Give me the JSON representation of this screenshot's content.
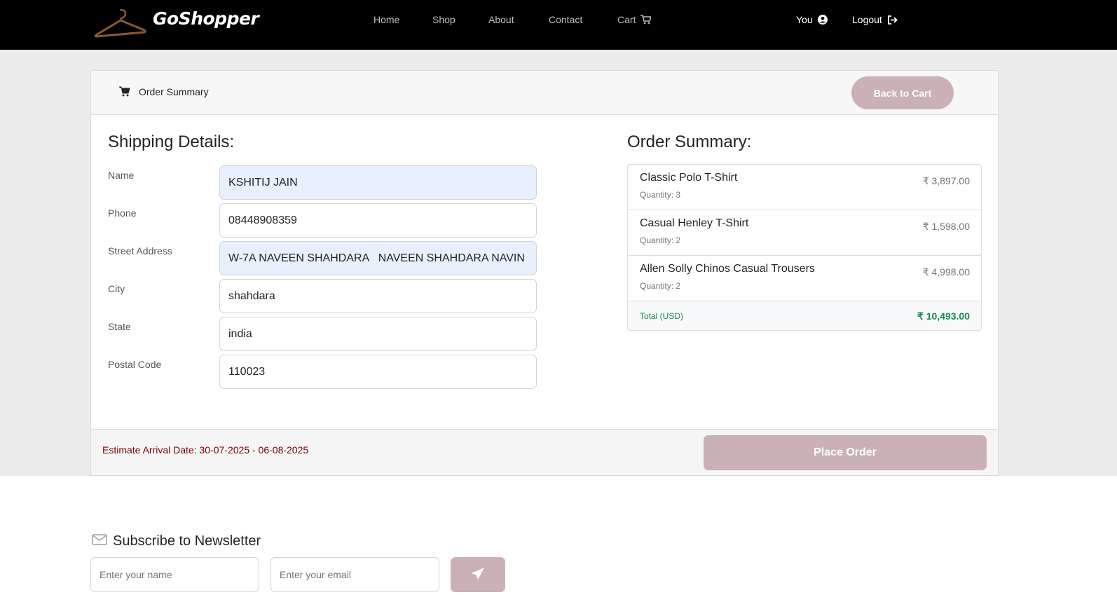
{
  "navbar": {
    "brand": "GoShopper",
    "links": {
      "home": "Home",
      "shop": "Shop",
      "about": "About",
      "contact": "Contact",
      "cart": "Cart"
    },
    "user_label": "You",
    "logout_label": "Logout"
  },
  "card_header": {
    "title": "Order Summary",
    "back_button": "Back to Cart"
  },
  "shipping": {
    "title": "Shipping Details:",
    "fields": [
      {
        "label": "Name",
        "value": "KSHITIJ JAIN"
      },
      {
        "label": "Phone",
        "value": "08448908359"
      },
      {
        "label": "Street Address",
        "value": "W-7A NAVEEN SHAHDARA   NAVEEN SHAHDARA NAVIN"
      },
      {
        "label": "City",
        "value": "shahdara"
      },
      {
        "label": "State",
        "value": "india"
      },
      {
        "label": "Postal Code",
        "value": "110023"
      }
    ]
  },
  "summary": {
    "title": "Order Summary:",
    "items": [
      {
        "name": "Classic Polo T-Shirt",
        "quantity": "Quantity: 3",
        "price": "₹ 3,897.00"
      },
      {
        "name": "Casual Henley T-Shirt",
        "quantity": "Quantity: 2",
        "price": "₹ 1,598.00"
      },
      {
        "name": "Allen Solly Chinos Casual Trousers",
        "quantity": "Quantity: 2",
        "price": "₹ 4,998.00"
      }
    ],
    "total_label": "Total (USD)",
    "total_value": "₹ 10,493.00"
  },
  "footer": {
    "arrival": "Estimate Arrival Date: 30-07-2025 - 06-08-2025",
    "place_order": "Place Order"
  },
  "newsletter": {
    "title": "Subscribe to Newsletter",
    "name_placeholder": "Enter your name",
    "email_placeholder": "Enter your email"
  },
  "colors": {
    "navbar_bg": "#000000",
    "page_bg": "#ececec",
    "button_bg": "#c9b1b6",
    "total_green": "#198754",
    "arrival_red": "#7a0000",
    "autofill_bg": "#e8f0fe"
  },
  "icons": {
    "brand": "hanger-icon",
    "cart": "cart-icon",
    "user": "user-circle-icon",
    "logout": "logout-icon",
    "newsletter": "envelope-icon",
    "send": "paper-plane-icon"
  }
}
